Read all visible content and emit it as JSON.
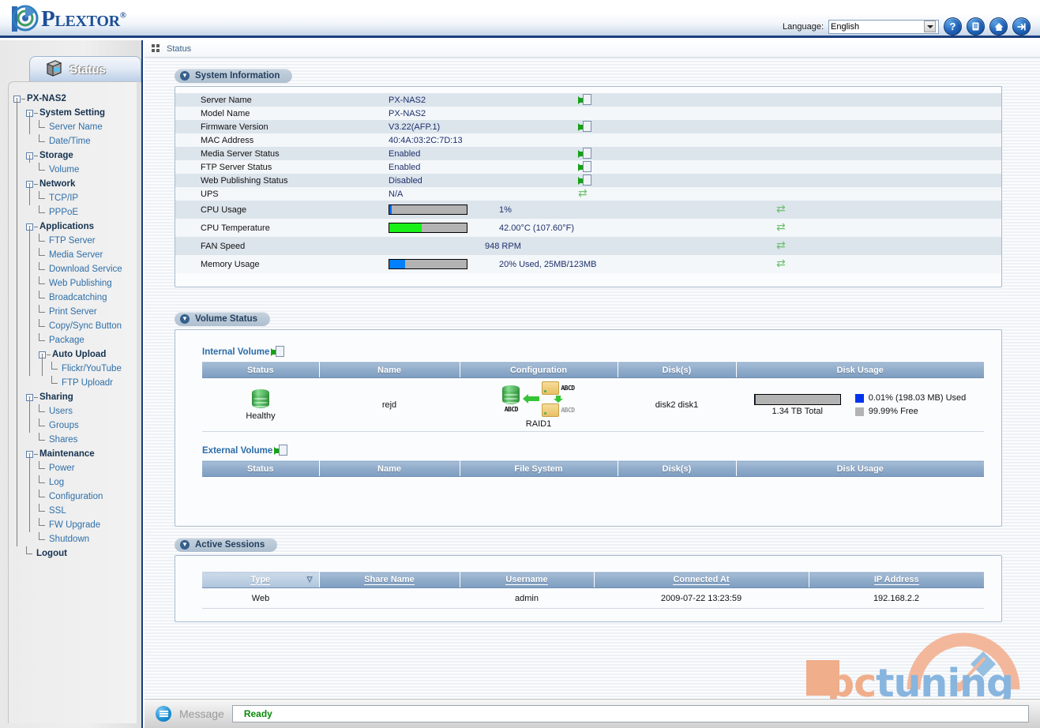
{
  "header": {
    "brand": "Plextor",
    "brand_reg": "®",
    "logo_icon": "plextor-swirl-logo",
    "language_label": "Language:",
    "language_value": "English",
    "icons": [
      {
        "name": "help-icon",
        "glyph": "?"
      },
      {
        "name": "manual-icon",
        "glyph": "☰"
      },
      {
        "name": "home-icon",
        "glyph": "⌂"
      },
      {
        "name": "logout-icon",
        "glyph": "→"
      }
    ],
    "accent_color": "#1b3f7e"
  },
  "sidebar": {
    "tab_label": "Status",
    "tab_icon": "server-monitor-icon",
    "tree": [
      {
        "label": "PX-NAS2",
        "depth": 0,
        "type": "node",
        "toggle": "-"
      },
      {
        "label": "System Setting",
        "depth": 1,
        "type": "node",
        "toggle": "-"
      },
      {
        "label": "Server Name",
        "depth": 2,
        "type": "leaf"
      },
      {
        "label": "Date/Time",
        "depth": 2,
        "type": "leaf",
        "last": true
      },
      {
        "label": "Storage",
        "depth": 1,
        "type": "node",
        "toggle": "-"
      },
      {
        "label": "Volume",
        "depth": 2,
        "type": "leaf",
        "last": true
      },
      {
        "label": "Network",
        "depth": 1,
        "type": "node",
        "toggle": "-"
      },
      {
        "label": "TCP/IP",
        "depth": 2,
        "type": "leaf"
      },
      {
        "label": "PPPoE",
        "depth": 2,
        "type": "leaf",
        "last": true
      },
      {
        "label": "Applications",
        "depth": 1,
        "type": "node",
        "toggle": "-"
      },
      {
        "label": "FTP Server",
        "depth": 2,
        "type": "leaf"
      },
      {
        "label": "Media Server",
        "depth": 2,
        "type": "leaf"
      },
      {
        "label": "Download Service",
        "depth": 2,
        "type": "leaf"
      },
      {
        "label": "Web Publishing",
        "depth": 2,
        "type": "leaf"
      },
      {
        "label": "Broadcatching",
        "depth": 2,
        "type": "leaf"
      },
      {
        "label": "Print Server",
        "depth": 2,
        "type": "leaf"
      },
      {
        "label": "Copy/Sync Button",
        "depth": 2,
        "type": "leaf"
      },
      {
        "label": "Package",
        "depth": 2,
        "type": "leaf"
      },
      {
        "label": "Auto Upload",
        "depth": 2,
        "type": "node",
        "toggle": "-"
      },
      {
        "label": "Flickr/YouTube",
        "depth": 3,
        "type": "leaf"
      },
      {
        "label": "FTP Uploadr",
        "depth": 3,
        "type": "leaf",
        "last": true
      },
      {
        "label": "Sharing",
        "depth": 1,
        "type": "node",
        "toggle": "-"
      },
      {
        "label": "Users",
        "depth": 2,
        "type": "leaf"
      },
      {
        "label": "Groups",
        "depth": 2,
        "type": "leaf"
      },
      {
        "label": "Shares",
        "depth": 2,
        "type": "leaf",
        "last": true
      },
      {
        "label": "Maintenance",
        "depth": 1,
        "type": "node",
        "toggle": "-"
      },
      {
        "label": "Power",
        "depth": 2,
        "type": "leaf"
      },
      {
        "label": "Log",
        "depth": 2,
        "type": "leaf"
      },
      {
        "label": "Configuration",
        "depth": 2,
        "type": "leaf"
      },
      {
        "label": "SSL",
        "depth": 2,
        "type": "leaf"
      },
      {
        "label": "FW Upgrade",
        "depth": 2,
        "type": "leaf"
      },
      {
        "label": "Shutdown",
        "depth": 2,
        "type": "leaf",
        "last": true
      },
      {
        "label": "Logout",
        "depth": 1,
        "type": "node",
        "toggle": "",
        "last": true
      }
    ]
  },
  "breadcrumb": {
    "icon": "grid-icon",
    "text": "Status"
  },
  "system_information": {
    "title": "System Information",
    "rows": [
      {
        "key": "Server Name",
        "value": "PX-NAS2",
        "icon": "goto-icon"
      },
      {
        "key": "Model Name",
        "value": "PX-NAS2",
        "icon": ""
      },
      {
        "key": "Firmware Version",
        "value": "V3.22(AFP.1)",
        "icon": "goto-icon"
      },
      {
        "key": "MAC Address",
        "value": "40:4A:03:2C:7D:13",
        "icon": ""
      },
      {
        "key": "Media Server Status",
        "value": "Enabled",
        "icon": "goto-icon"
      },
      {
        "key": "FTP Server Status",
        "value": "Enabled",
        "icon": "goto-icon"
      },
      {
        "key": "Web Publishing Status",
        "value": "Disabled",
        "icon": "goto-icon"
      },
      {
        "key": "UPS",
        "value": "N/A",
        "icon": "refresh-icon"
      }
    ],
    "meters": [
      {
        "key": "CPU Usage",
        "value": "1%",
        "percent": 1,
        "color": "#0066ff",
        "icon": "refresh-icon"
      },
      {
        "key": "CPU Temperature",
        "value": "42.00°C (107.60°F)",
        "percent": 42,
        "color": "#18f018",
        "icon": "refresh-icon"
      },
      {
        "key": "FAN Speed",
        "value": "948 RPM",
        "percent": null,
        "color": "",
        "icon": "refresh-icon"
      },
      {
        "key": "Memory Usage",
        "value": "20% Used, 25MB/123MB",
        "percent": 20,
        "color": "#0080ff",
        "icon": "refresh-icon"
      }
    ]
  },
  "volume_status": {
    "title": "Volume Status",
    "internal": {
      "link_label": "Internal Volume",
      "link_icon": "goto-icon",
      "columns": [
        "Status",
        "Name",
        "Configuration",
        "Disk(s)",
        "Disk Usage"
      ],
      "row": {
        "status": "Healthy",
        "status_icon": "green-cylinder-icon",
        "name": "rejd",
        "configuration": "RAID1",
        "config_icon": "raid1-diagram-icon",
        "config_labels": [
          "ABCD",
          "ABCD",
          "ABCD"
        ],
        "disks": "disk2 disk1",
        "total": "1.34 TB Total",
        "used_pct": 0.01,
        "used_label": "0.01% (198.03 MB) Used",
        "free_label": "99.99% Free",
        "used_color": "#0033ee",
        "free_color": "#b3b3b3"
      }
    },
    "external": {
      "link_label": "External Volume",
      "link_icon": "goto-icon",
      "columns": [
        "Status",
        "Name",
        "File System",
        "Disk(s)",
        "Disk Usage"
      ],
      "rows": []
    }
  },
  "active_sessions": {
    "title": "Active Sessions",
    "columns": [
      "Type",
      "Share Name",
      "Username",
      "Connected At",
      "IP Address"
    ],
    "sort_column": "Type",
    "sort_indicator": "▽",
    "rows": [
      {
        "type": "Web",
        "share_name": "",
        "username": "admin",
        "connected_at": "2009-07-22 13:23:59",
        "ip_address": "192.168.2.2"
      }
    ]
  },
  "footer": {
    "icon": "message-bubble-icon",
    "label": "Message",
    "status": "Ready",
    "status_color": "#0a8a0a"
  },
  "watermark": {
    "text_a": "pc",
    "text_b": "tuning",
    "color_a": "#f0a882",
    "color_b": "#7fb0dd"
  }
}
